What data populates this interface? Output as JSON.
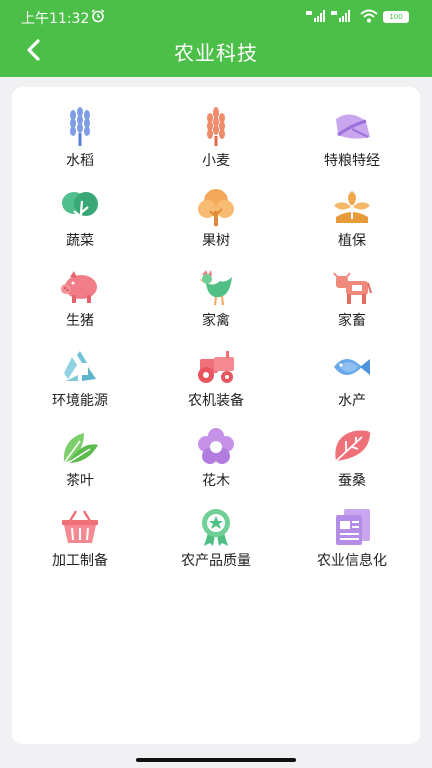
{
  "status_bar": {
    "time": "上午11:32",
    "battery": "100"
  },
  "header": {
    "title": "农业科技"
  },
  "categories": [
    {
      "label": "水稻",
      "icon": "rice-icon"
    },
    {
      "label": "小麦",
      "icon": "wheat-icon"
    },
    {
      "label": "特粮特经",
      "icon": "special-grain-icon"
    },
    {
      "label": "蔬菜",
      "icon": "vegetable-icon"
    },
    {
      "label": "果树",
      "icon": "fruit-tree-icon"
    },
    {
      "label": "植保",
      "icon": "plant-protection-icon"
    },
    {
      "label": "生猪",
      "icon": "pig-icon"
    },
    {
      "label": "家禽",
      "icon": "rooster-icon"
    },
    {
      "label": "家畜",
      "icon": "cattle-icon"
    },
    {
      "label": "环境能源",
      "icon": "recycle-icon"
    },
    {
      "label": "农机装备",
      "icon": "tractor-icon"
    },
    {
      "label": "水产",
      "icon": "fish-icon"
    },
    {
      "label": "茶叶",
      "icon": "tea-leaf-icon"
    },
    {
      "label": "花木",
      "icon": "flower-icon"
    },
    {
      "label": "蚕桑",
      "icon": "mulberry-leaf-icon"
    },
    {
      "label": "加工制备",
      "icon": "basket-icon"
    },
    {
      "label": "农产品质量",
      "icon": "quality-award-icon"
    },
    {
      "label": "农业信息化",
      "icon": "info-document-icon"
    }
  ],
  "colors": {
    "header": "#4cbf48",
    "background": "#f1f1f3",
    "card": "#ffffff",
    "rice": "#7f9ee6",
    "wheat": "#ef8a6a",
    "special_grain": "#b98ee6",
    "vegetable": "#4fc08d",
    "fruit_tree": "#f4a85a",
    "plant_protection": "#f1a850",
    "pig": "#f07d87",
    "rooster": "#6fcf97",
    "cattle": "#f08a7d",
    "recycle": "#6fc3d6",
    "tractor": "#f0707a",
    "fish": "#6aa9e9",
    "tea": "#7ccf6a",
    "flower": "#c592e8",
    "mulberry": "#f0707a",
    "basket": "#f0707a",
    "award": "#6fcf97",
    "document": "#b48ee6"
  }
}
